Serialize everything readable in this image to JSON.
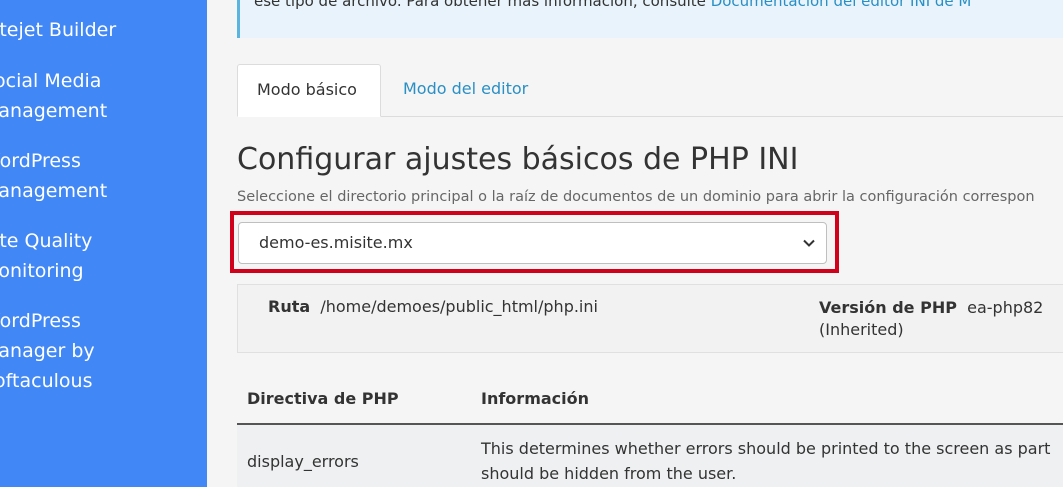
{
  "sidebar": {
    "items": [
      {
        "line1": "Sitejet Builder",
        "line2": ""
      },
      {
        "line1": "Social Media",
        "line2": "Management"
      },
      {
        "line1": "WordPress",
        "line2": "Management"
      },
      {
        "line1": "Site Quality",
        "line2": "Monitoring"
      },
      {
        "line1": "WordPress",
        "line2": "Manager by",
        "line3": "Softaculous"
      }
    ]
  },
  "notice": {
    "text": "ese tipo de archivo. Para obtener más información, consulte ",
    "link": "Documentación del editor INI de M"
  },
  "tabs": [
    {
      "label": "Modo básico",
      "active": true
    },
    {
      "label": "Modo del editor",
      "active": false
    }
  ],
  "page": {
    "title": "Configurar ajustes básicos de PHP INI",
    "subtitle": "Seleccione el directorio principal o la raíz de documentos de un dominio para abrir la configuración correspon"
  },
  "domain_select": {
    "value": "demo-es.misite.mx"
  },
  "info": {
    "path_label": "Ruta",
    "path_value": "/home/demoes/public_html/php.ini",
    "version_label": "Versión de PHP",
    "version_value": "ea-php82",
    "version_note": "(Inherited)"
  },
  "table": {
    "headers": [
      "Directiva de PHP",
      "Información"
    ],
    "rows": [
      {
        "directive": "display_errors",
        "info_line1": "This determines whether errors should be printed to the screen as part",
        "info_line2": "should be hidden from the user."
      }
    ]
  },
  "colors": {
    "sidebar": "#4187f5",
    "highlight": "#d0021b",
    "link": "#2a8fc4"
  }
}
